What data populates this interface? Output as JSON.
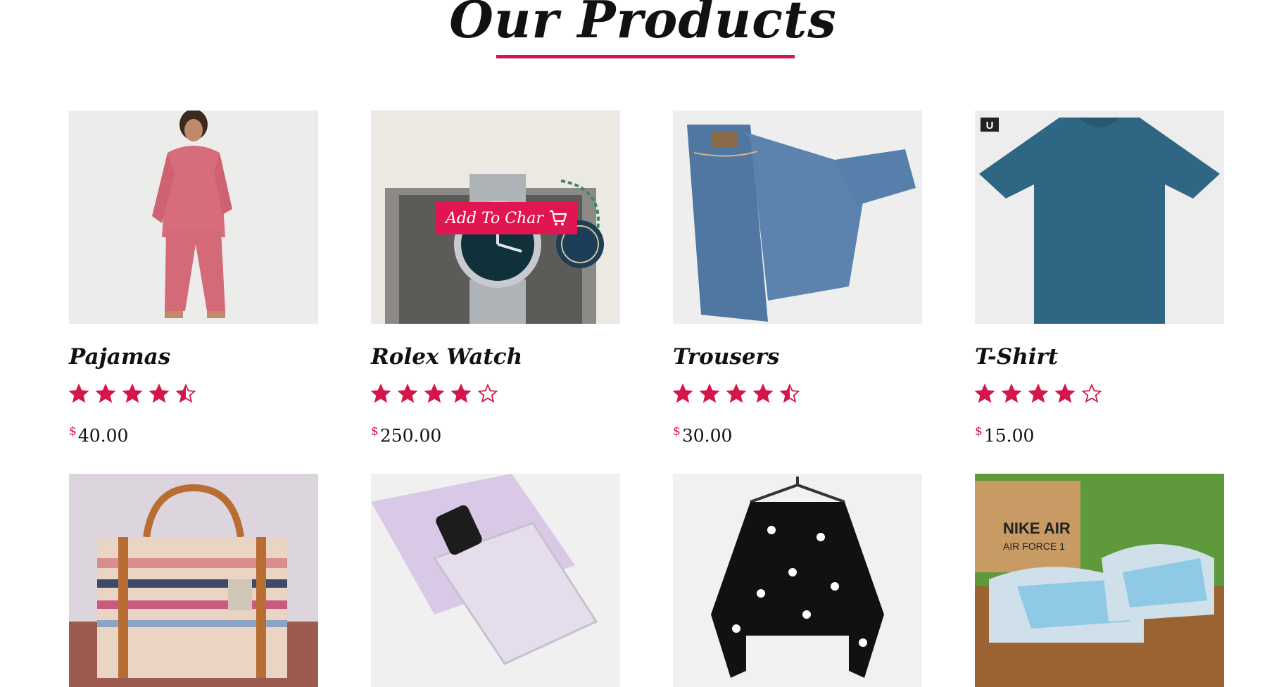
{
  "section": {
    "title": "Our Products"
  },
  "colors": {
    "accent": "#d3174a",
    "star": "#d3174a"
  },
  "products": [
    {
      "name": "Pajamas",
      "currency": "$",
      "price": "40.00",
      "rating": 4.5,
      "image_icon": "pajamas-photo"
    },
    {
      "name": "Rolex Watch",
      "currency": "$",
      "price": "250.00",
      "rating": 4,
      "image_icon": "watch-photo",
      "add_to_cart_label": "Add To Char"
    },
    {
      "name": "Trousers",
      "currency": "$",
      "price": "30.00",
      "rating": 4.5,
      "image_icon": "jeans-photo"
    },
    {
      "name": "T-Shirt",
      "currency": "$",
      "price": "15.00",
      "rating": 4,
      "image_icon": "tshirt-photo",
      "brand_badge": "U"
    },
    {
      "image_icon": "handbag-photo"
    },
    {
      "image_icon": "perfume-photo"
    },
    {
      "image_icon": "blouse-photo"
    },
    {
      "image_icon": "sneakers-photo",
      "box_brand_top": "NIKE AIR",
      "box_brand_bottom": "AIR FORCE 1"
    }
  ]
}
